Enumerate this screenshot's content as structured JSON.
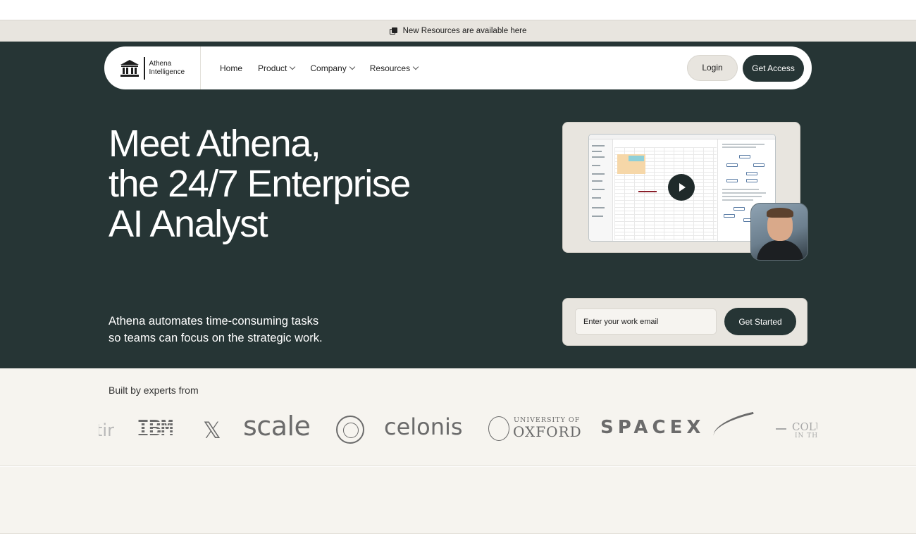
{
  "announcement": {
    "text": "New Resources are available here",
    "icon": "stacked-pages-icon"
  },
  "brand": {
    "line1": "Athena",
    "line2": "Intelligence",
    "icon": "classical-building-icon"
  },
  "nav": {
    "items": [
      {
        "label": "Home",
        "has_dropdown": false
      },
      {
        "label": "Product",
        "has_dropdown": true
      },
      {
        "label": "Company",
        "has_dropdown": true
      },
      {
        "label": "Resources",
        "has_dropdown": true
      }
    ],
    "login_label": "Login",
    "access_label": "Get Access"
  },
  "hero": {
    "headline_lines": [
      "Meet Athena,",
      "the 24/7 Enterprise",
      "AI Analyst"
    ],
    "subtext_lines": [
      "Athena automates time-consuming tasks",
      "so teams can focus on the strategic work."
    ],
    "video": {
      "play_icon": "play-icon"
    },
    "email": {
      "placeholder": "Enter your work email",
      "value": "",
      "button_label": "Get Started"
    }
  },
  "logos": {
    "label": "Built by experts from",
    "items": [
      "Palantir",
      "IBM",
      "X",
      "scale",
      "Cornell University",
      "celonis",
      "University of Oxford",
      "SpaceX",
      "Columbia University"
    ],
    "visible_text": {
      "palantir": "tir",
      "ibm": "IBM",
      "x": "𝕏",
      "scale": "scale",
      "celonis": "celonis",
      "oxford_small": "UNIVERSITY OF",
      "oxford_big": "OXFORD",
      "spacex": "SPACEX",
      "columbia": "COLU",
      "columbia_sub": "IN THE"
    }
  },
  "colors": {
    "hero_bg": "#263535",
    "cream": "#e8e5df",
    "section_bg": "#f6f4ef",
    "text_dark": "#1d1d1d"
  }
}
